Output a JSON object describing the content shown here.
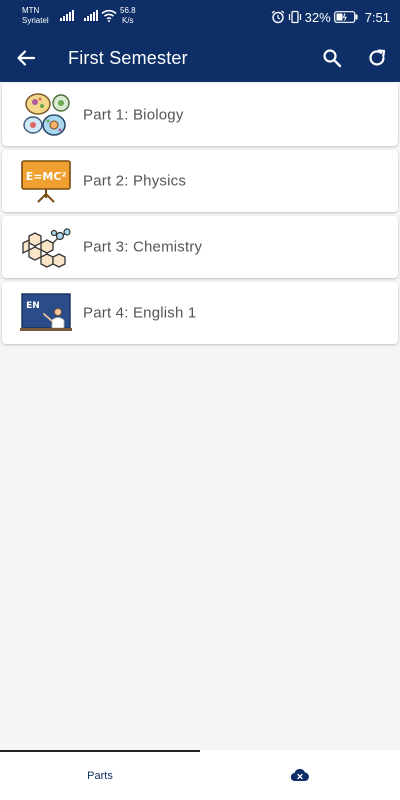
{
  "status_bar": {
    "carrier_1": "MTN",
    "carrier_2": "Syriatel",
    "net_speed_value": "56.8",
    "net_speed_unit": "K/s",
    "battery": "32%",
    "time": "7:51"
  },
  "app_bar": {
    "title": "First Semester",
    "back_icon": "arrow-back-icon",
    "search_icon": "search-icon",
    "refresh_icon": "refresh-icon"
  },
  "parts": [
    {
      "label": "Part 1: Biology",
      "icon": "biology-cells-icon"
    },
    {
      "label": "Part 2: Physics",
      "icon": "physics-board-icon"
    },
    {
      "label": "Part 3: Chemistry",
      "icon": "chemistry-molecule-icon"
    },
    {
      "label": "Part 4: English 1",
      "icon": "english-teacher-icon"
    }
  ],
  "bottom_nav": {
    "tabs": [
      {
        "label": "Parts",
        "active": true
      },
      {
        "icon": "cloud-off-icon",
        "active": false
      }
    ]
  },
  "colors": {
    "primary": "#0d2e66",
    "background": "#f5f5f5",
    "card": "#ffffff",
    "label_text": "#555555"
  }
}
